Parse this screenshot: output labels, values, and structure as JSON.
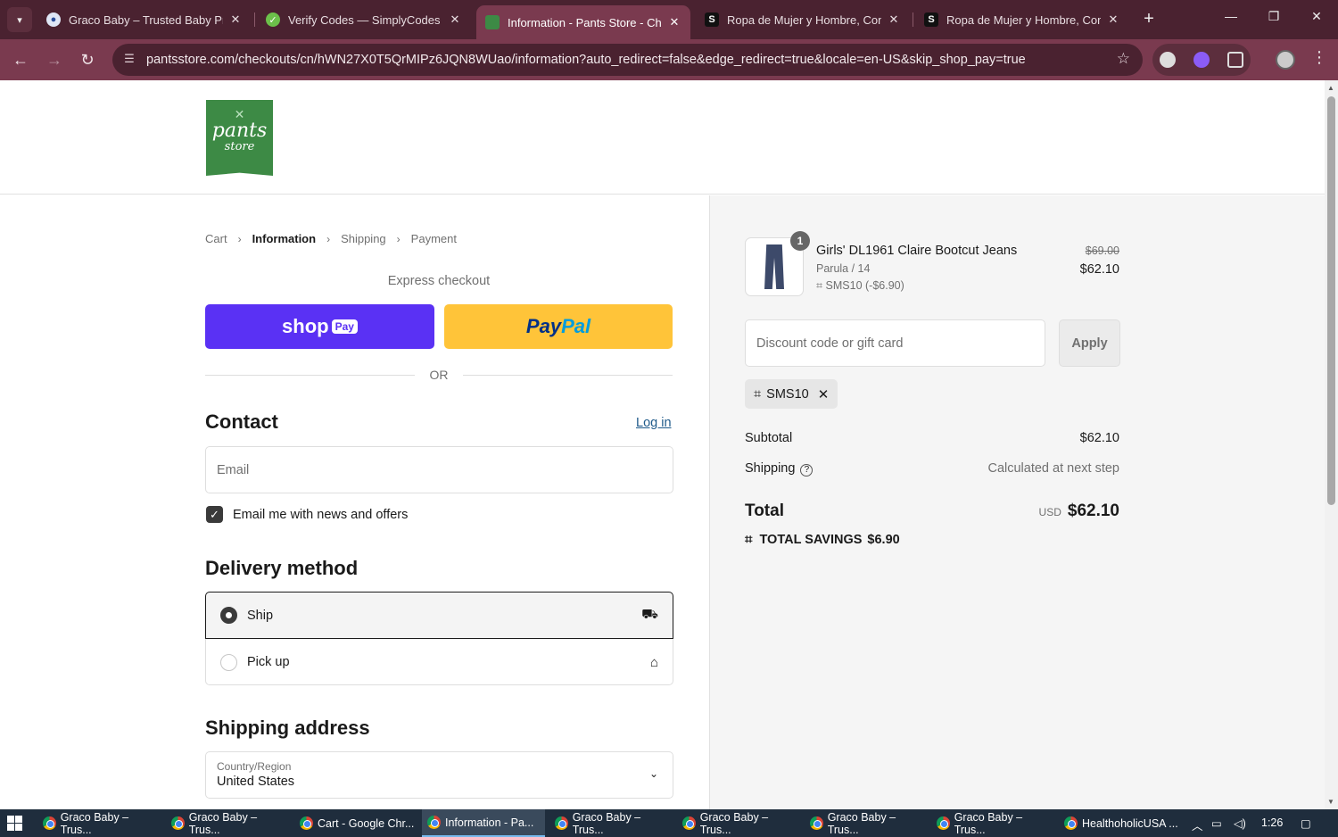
{
  "browser": {
    "tabs": [
      {
        "title": "Graco Baby – Trusted Baby Products",
        "active": false
      },
      {
        "title": "Verify Codes — SimplyCodes",
        "active": false
      },
      {
        "title": "Information - Pants Store - Checkout",
        "active": true
      },
      {
        "title": "Ropa de Mujer y Hombre, Comprar",
        "active": false
      },
      {
        "title": "Ropa de Mujer y Hombre, Comprar",
        "active": false
      }
    ],
    "url": "pantsstore.com/checkouts/cn/hWN27X0T5QrMIPz6JQN8WUao/information?auto_redirect=false&edge_redirect=true&locale=en-US&skip_shop_pay=true"
  },
  "store": {
    "logo_line1": "pants",
    "logo_line2": "store"
  },
  "breadcrumb": {
    "cart": "Cart",
    "information": "Information",
    "shipping": "Shipping",
    "payment": "Payment"
  },
  "express": {
    "title": "Express checkout",
    "shop_label": "shop",
    "shop_pill": "Pay",
    "paypal_a": "Pay",
    "paypal_b": "Pal",
    "or": "OR"
  },
  "contact": {
    "title": "Contact",
    "login": "Log in",
    "email_placeholder": "Email",
    "newsletter_label": "Email me with news and offers",
    "newsletter_checked": true
  },
  "delivery": {
    "title": "Delivery method",
    "ship": "Ship",
    "pickup": "Pick up",
    "selected": "Ship"
  },
  "shipping_address": {
    "title": "Shipping address",
    "country_label": "Country/Region",
    "country_value": "United States"
  },
  "order": {
    "quantity": "1",
    "product_name": "Girls' DL1961 Claire Bootcut Jeans",
    "variant": "Parula / 14",
    "discount_line": "SMS10 (-$6.90)",
    "original_price": "$69.00",
    "price": "$62.10",
    "discount_placeholder": "Discount code or gift card",
    "apply": "Apply",
    "applied_code": "SMS10",
    "subtotal_label": "Subtotal",
    "subtotal_value": "$62.10",
    "shipping_label": "Shipping",
    "shipping_value": "Calculated at next step",
    "total_label": "Total",
    "currency": "USD",
    "total_value": "$62.10",
    "savings_label": "TOTAL SAVINGS",
    "savings_value": "$6.90"
  },
  "taskbar": {
    "items": [
      "Graco Baby – Trus...",
      "Graco Baby – Trus...",
      "Cart - Google Chr...",
      "Information - Pa...",
      "Graco Baby – Trus...",
      "Graco Baby – Trus...",
      "Graco Baby – Trus...",
      "Graco Baby – Trus...",
      "HealthoholicUSA ..."
    ],
    "time": "1:26"
  },
  "colors": {
    "shop_pay": "#5a31f4",
    "paypal": "#ffc439",
    "logo_green": "#3d8a45",
    "browser_frame": "#7a3a4f"
  }
}
